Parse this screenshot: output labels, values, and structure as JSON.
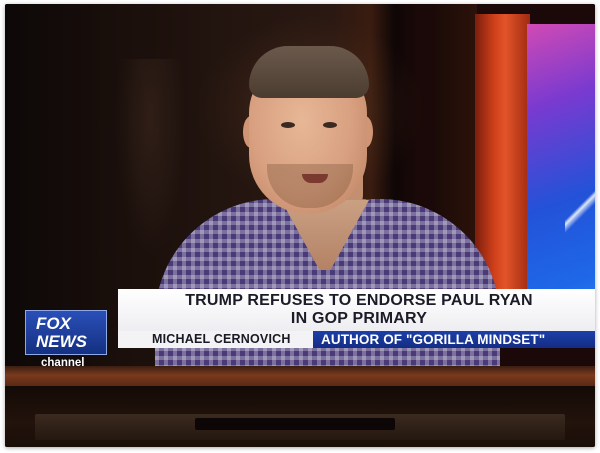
{
  "broadcast": {
    "headline_lines": [
      "TRUMP REFUSES TO ENDORSE PAUL RYAN",
      "IN GOP PRIMARY"
    ],
    "guest_name": "MICHAEL CERNOVICH",
    "guest_role": "AUTHOR OF \"GORILLA MINDSET\"",
    "logo": {
      "line1": "FOX",
      "line2": "NEWS",
      "suffix": "channel"
    }
  },
  "colors": {
    "lower_third_bg": "#ffffff",
    "role_bar": "#1c3fa8",
    "logo_blue": "#2a4fb8",
    "studio_red": "#d0401a",
    "studio_screen_blue": "#2352d8"
  }
}
